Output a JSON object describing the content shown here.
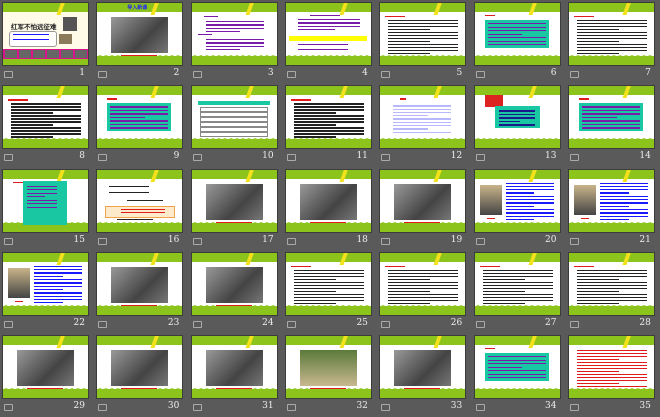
{
  "view": "slide-sorter",
  "colors": {
    "green": "#8cc41c",
    "yellow": "#f3e21b",
    "teal": "#19c7a3",
    "red": "#e11b1b",
    "blue": "#1a1aff",
    "purple": "#7a1aa8"
  },
  "slides": [
    {
      "number": "1",
      "type": "cover",
      "title": "红军不怕远征难"
    },
    {
      "number": "2",
      "type": "photo",
      "title": "导入新课"
    },
    {
      "number": "3",
      "type": "text-purple"
    },
    {
      "number": "4",
      "type": "text-purple-yellow"
    },
    {
      "number": "5",
      "type": "text"
    },
    {
      "number": "6",
      "type": "teal"
    },
    {
      "number": "7",
      "type": "text"
    },
    {
      "number": "8",
      "type": "text"
    },
    {
      "number": "9",
      "type": "teal"
    },
    {
      "number": "10",
      "type": "table"
    },
    {
      "number": "11",
      "type": "text"
    },
    {
      "number": "12",
      "type": "faint"
    },
    {
      "number": "13",
      "type": "flag"
    },
    {
      "number": "14",
      "type": "teal"
    },
    {
      "number": "15",
      "type": "teal-tall"
    },
    {
      "number": "16",
      "type": "poem"
    },
    {
      "number": "17",
      "type": "photo"
    },
    {
      "number": "18",
      "type": "photo"
    },
    {
      "number": "19",
      "type": "photo"
    },
    {
      "number": "20",
      "type": "portrait"
    },
    {
      "number": "21",
      "type": "portrait"
    },
    {
      "number": "22",
      "type": "portrait"
    },
    {
      "number": "23",
      "type": "photo"
    },
    {
      "number": "24",
      "type": "photo"
    },
    {
      "number": "25",
      "type": "text"
    },
    {
      "number": "26",
      "type": "text"
    },
    {
      "number": "27",
      "type": "text"
    },
    {
      "number": "28",
      "type": "text"
    },
    {
      "number": "29",
      "type": "photo"
    },
    {
      "number": "30",
      "type": "photo"
    },
    {
      "number": "31",
      "type": "photo"
    },
    {
      "number": "32",
      "type": "photo-color"
    },
    {
      "number": "33",
      "type": "photo"
    },
    {
      "number": "34",
      "type": "teal"
    },
    {
      "number": "35",
      "type": "text-red"
    }
  ]
}
